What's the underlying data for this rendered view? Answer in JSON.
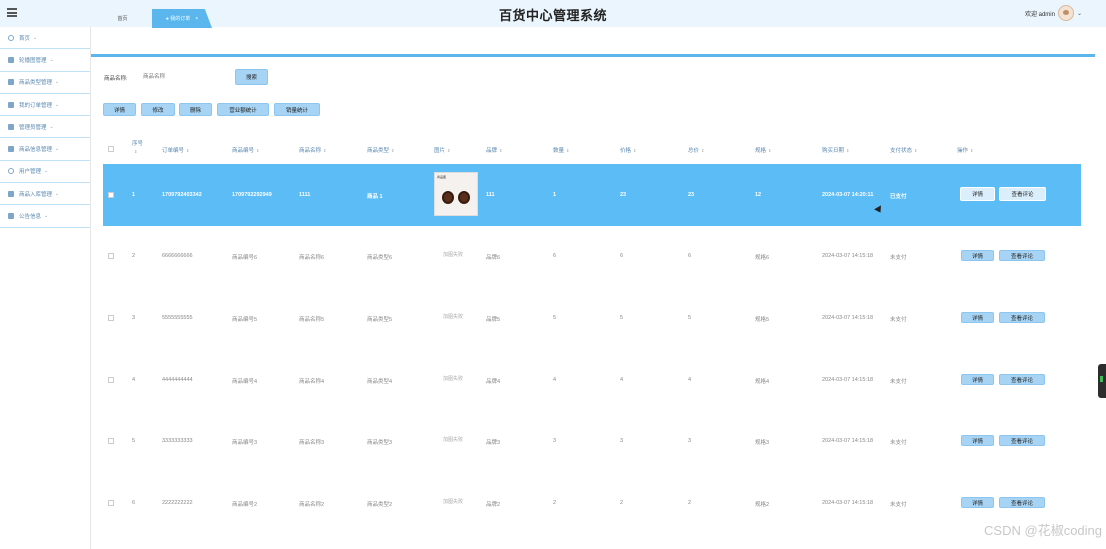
{
  "header": {
    "title": "百货中心管理系统",
    "welcome": "欢迎 admin"
  },
  "sidebar": {
    "items": [
      {
        "label": "首页",
        "arrow": "⌄"
      },
      {
        "label": "轮播图管理",
        "arrow": "⌄"
      },
      {
        "label": "商品类型管理",
        "arrow": "⌄"
      },
      {
        "label": "我的订单管理",
        "arrow": "⌄"
      },
      {
        "label": "管理员管理",
        "arrow": "⌄"
      },
      {
        "label": "商品信息管理",
        "arrow": "⌄"
      },
      {
        "label": "用户管理",
        "arrow": "⌄"
      },
      {
        "label": "商品入库管理",
        "arrow": "⌄"
      },
      {
        "label": "公告信息",
        "arrow": "⌄"
      }
    ]
  },
  "tabs": {
    "home": "首页",
    "active": "● 我的订单",
    "active_close": "×"
  },
  "search": {
    "label": "商品名称:",
    "placeholder": "商品名称",
    "button": "搜索"
  },
  "toolbar": {
    "detail": "详情",
    "edit": "修改",
    "delete": "删除",
    "revenue_stats": "营业额统计",
    "sales_stats": "销量统计"
  },
  "table": {
    "headers": [
      "序号",
      "订单编号",
      "商品编号",
      "商品名称",
      "商品类型",
      "图片",
      "品牌",
      "数量",
      "价格",
      "总价",
      "规格",
      "购买日期",
      "支付状态",
      "操作"
    ],
    "row_buttons": {
      "detail": "详情",
      "comments": "查看评论"
    },
    "image_placeholder": "加图失败",
    "rows": [
      {
        "no": "1",
        "order": "1709792403342",
        "code": "1709792292949",
        "name": "1111",
        "type": "商品 1",
        "brand": "111",
        "qty": "1",
        "price": "23",
        "total": "23",
        "spec": "12",
        "date": "2024-03-07 14:20:11",
        "status": "已支付",
        "image_label": "商品图"
      },
      {
        "no": "2",
        "order": "6666666666",
        "code": "商品编号6",
        "name": "商品名称6",
        "type": "商品类型6",
        "brand": "品牌6",
        "qty": "6",
        "price": "6",
        "total": "6",
        "spec": "规格6",
        "date": "2024-03-07 14:15:18",
        "status": "未支付"
      },
      {
        "no": "3",
        "order": "5555555555",
        "code": "商品编号5",
        "name": "商品名称5",
        "type": "商品类型5",
        "brand": "品牌5",
        "qty": "5",
        "price": "5",
        "total": "5",
        "spec": "规格5",
        "date": "2024-03-07 14:15:18",
        "status": "未支付"
      },
      {
        "no": "4",
        "order": "4444444444",
        "code": "商品编号4",
        "name": "商品名称4",
        "type": "商品类型4",
        "brand": "品牌4",
        "qty": "4",
        "price": "4",
        "total": "4",
        "spec": "规格4",
        "date": "2024-03-07 14:15:18",
        "status": "未支付"
      },
      {
        "no": "5",
        "order": "3333333333",
        "code": "商品编号3",
        "name": "商品名称3",
        "type": "商品类型3",
        "brand": "品牌3",
        "qty": "3",
        "price": "3",
        "total": "3",
        "spec": "规格3",
        "date": "2024-03-07 14:15:18",
        "status": "未支付"
      },
      {
        "no": "6",
        "order": "2222222222",
        "code": "商品编号2",
        "name": "商品名称2",
        "type": "商品类型2",
        "brand": "品牌2",
        "qty": "2",
        "price": "2",
        "total": "2",
        "spec": "规格2",
        "date": "2024-03-07 14:15:18",
        "status": "未支付"
      }
    ]
  },
  "watermark": "CSDN @花椒coding"
}
